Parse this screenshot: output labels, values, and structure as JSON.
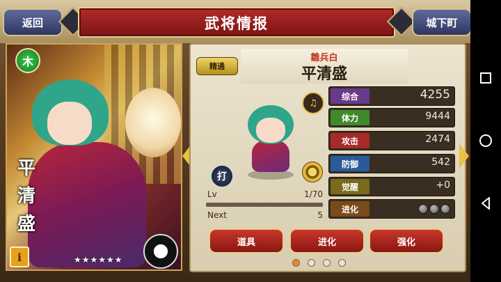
{
  "header": {
    "title": "武将情报",
    "back_label": "返回",
    "town_label": "城下町"
  },
  "portrait": {
    "element_label": "木",
    "name_vertical": "平\n清\n盛",
    "info_label": "i",
    "stars": "★★★★★★",
    "rarity_count": 6
  },
  "character": {
    "master_label": "精通",
    "title": "雛兵白",
    "name": "平清盛"
  },
  "level": {
    "label": "Lv",
    "value": "1/70",
    "progress": 0.0,
    "next_label": "Next",
    "next_value": "5"
  },
  "stats": {
    "total": {
      "label": "综合",
      "value": "4255",
      "color": "#6a3a8a"
    },
    "hp": {
      "label": "体力",
      "value": "9444",
      "color": "#3f8a2a"
    },
    "attack": {
      "label": "攻击",
      "value": "2474",
      "color": "#a82a2a"
    },
    "defense": {
      "label": "防御",
      "value": "542",
      "color": "#2a5a9a"
    },
    "awaken": {
      "label": "觉醒",
      "value": "+0",
      "color": "#7a6a1a"
    },
    "evolution": {
      "label": "进化",
      "color": "#7a4a1a",
      "orbs": 3
    }
  },
  "actions": {
    "items": "道具",
    "evolve": "进化",
    "enhance": "强化"
  },
  "pager": {
    "count": 4,
    "active": 0
  },
  "icons": {
    "sound": "speaker-icon",
    "weapon": "打",
    "skill": "gear-icon"
  },
  "colors": {
    "accent_gold": "#e8c240",
    "title_red": "#b32a2a",
    "panel_bg": "#ece4cf"
  }
}
